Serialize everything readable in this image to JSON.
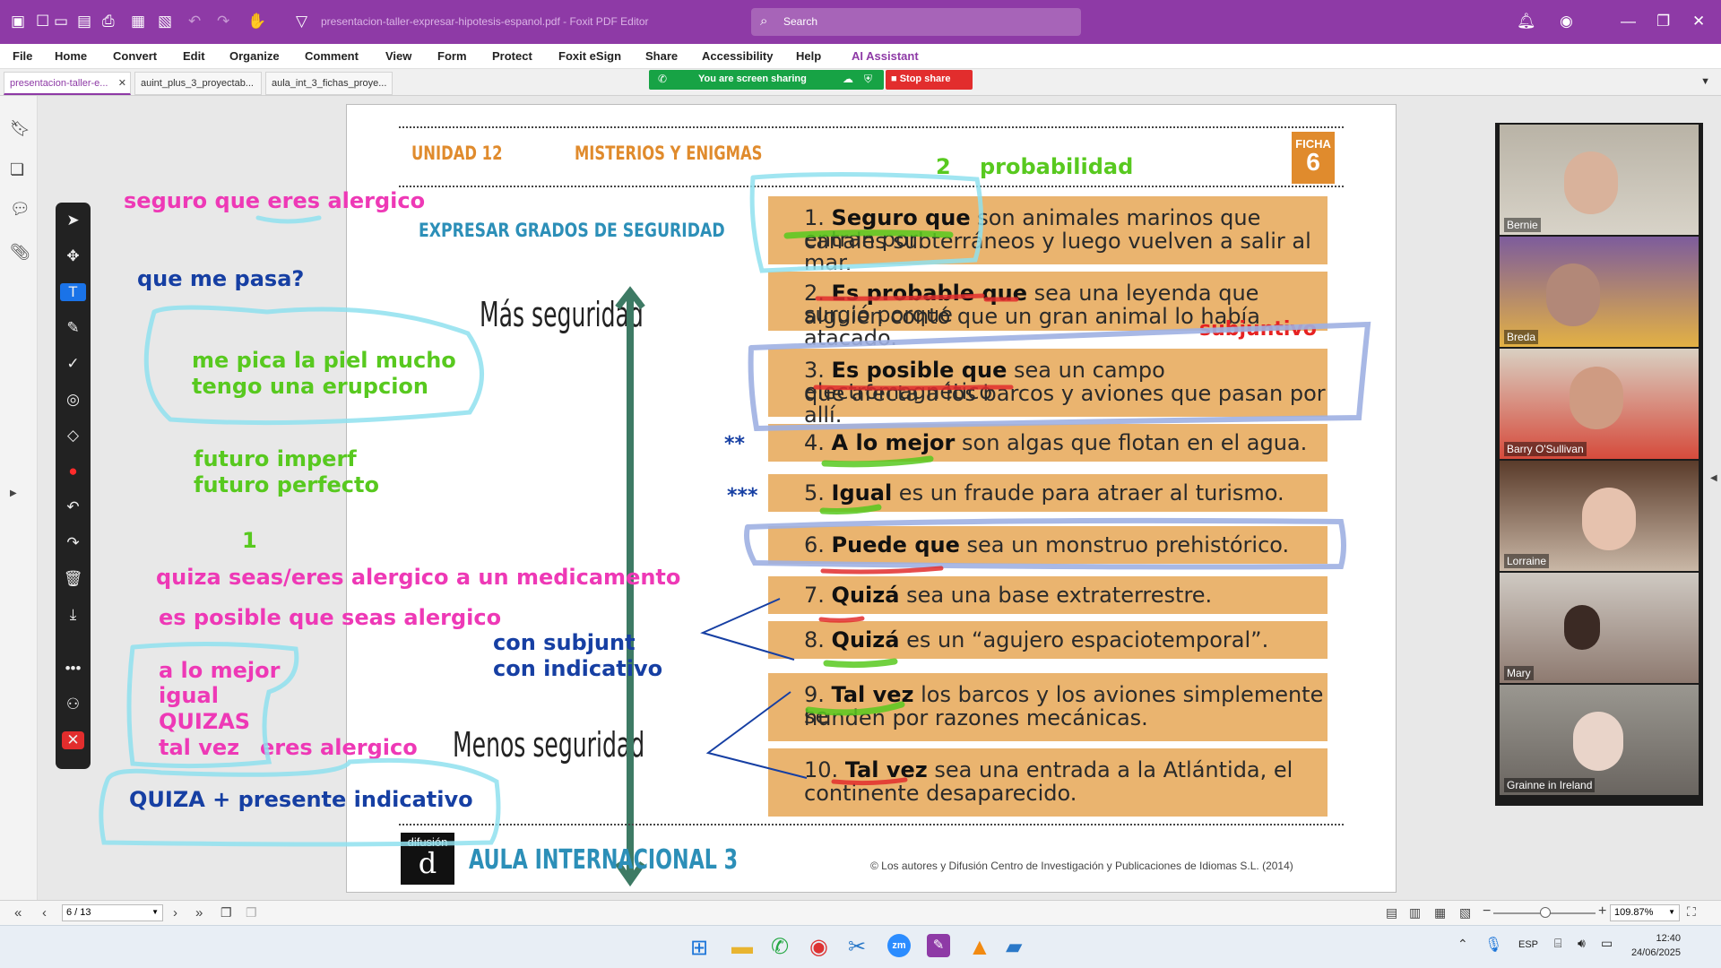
{
  "app": {
    "document_title": "presentacion-taller-expresar-hipotesis-espanol.pdf - Foxit PDF Editor",
    "search_placeholder": "Search"
  },
  "menu": [
    "File",
    "Home",
    "Convert",
    "Edit",
    "Organize",
    "Comment",
    "View",
    "Form",
    "Protect",
    "Foxit eSign",
    "Share",
    "Accessibility",
    "Help",
    "AI Assistant"
  ],
  "tabs": [
    "presentacion-taller-e...",
    "auint_plus_3_proyectab...",
    "aula_int_3_fichas_proye..."
  ],
  "share": {
    "status": "You are screen sharing",
    "stop": "Stop share"
  },
  "pdf": {
    "unit": "UNIDAD 12",
    "topic": "MISTERIOS Y ENIGMAS",
    "ficha_label": "FICHA",
    "ficha_num": "6",
    "heading": "EXPRESAR GRADOS DE SEGURIDAD",
    "mas": "Más seguridad",
    "menos": "Menos seguridad",
    "brand": "AULA INTERNACIONAL 3",
    "logo": "difusión",
    "copyright": "© Los autores y Difusión Centro de Investigación y Publicaciones de Idiomas S.L. (2014)",
    "rows": [
      {
        "n": "1.",
        "bold": "Seguro que",
        "rest": " son animales marinos que entran por",
        "line2": "canales subterráneos y luego vuelven a salir al mar."
      },
      {
        "n": "2.",
        "bold": "Es probable que",
        "rest": " sea una leyenda que surgió porque",
        "line2": "alguien contó que un gran animal lo había atacado."
      },
      {
        "n": "3.",
        "bold": "Es posible que",
        "rest": " sea un campo electromagnético",
        "line2": "que afecta a los barcos y aviones que pasan por allí."
      },
      {
        "n": "4.",
        "bold": "A lo mejor",
        "rest": " son algas que flotan en el agua.",
        "line2": ""
      },
      {
        "n": "5.",
        "bold": "Igual",
        "rest": " es un fraude para atraer al turismo.",
        "line2": ""
      },
      {
        "n": "6.",
        "bold": "Puede que",
        "rest": " sea un monstruo prehistórico.",
        "line2": ""
      },
      {
        "n": "7.",
        "bold": "Quizá",
        "rest": " sea una base extraterrestre.",
        "line2": ""
      },
      {
        "n": "8.",
        "bold": "Quizá",
        "rest": " es un “agujero espaciotemporal”.",
        "line2": ""
      },
      {
        "n": "9.",
        "bold": "Tal vez",
        "rest": " los barcos y los aviones simplemente se",
        "line2": "hunden por razones mecánicas."
      },
      {
        "n": "10.",
        "bold": "Tal vez",
        "rest": " sea una entrada a la Atlántida, el",
        "line2": "continente desaparecido."
      }
    ]
  },
  "annotations": {
    "seguro": "seguro que eres alergico",
    "quemepasa": "que me pasa?",
    "pica1": "me pica la piel mucho",
    "pica2": "tengo una erupcion",
    "fut1": "futuro imperf",
    "fut2": "futuro perfecto",
    "one": "1",
    "quiza": "quiza seas/eres alergico a un medicamento",
    "esposible": "es posible que seas alergico",
    "alomejor": "a lo mejor",
    "igual": "igual",
    "quizas": "QUIZAS",
    "talvez": "tal vez",
    "eres": "eres alergico",
    "quizaplus": "QUIZA + presente indicativo",
    "consubj": "con subjunt",
    "conind": "con indicativo",
    "two": "2",
    "prob": "probabilidad",
    "subj": "subjuntivo",
    "stars2": "**",
    "stars3": "***"
  },
  "participants": [
    "Bernie",
    "Breda",
    "Barry O'Sullivan",
    "Lorraine",
    "Mary",
    "Grainne in Ireland"
  ],
  "status": {
    "page": "6 / 13",
    "zoom": "109.87%"
  },
  "taskbar": {
    "lang": "ESP",
    "time": "12:40",
    "date": "24/06/2025"
  },
  "colors": {
    "titlebar": "#8e3aa6",
    "row": "#eab46f",
    "pink": "#ee39b6",
    "green": "#58c91f",
    "blue": "#163fa3",
    "arrow": "#3d7a64",
    "share": "#17a345",
    "stop": "#e22d2d"
  }
}
